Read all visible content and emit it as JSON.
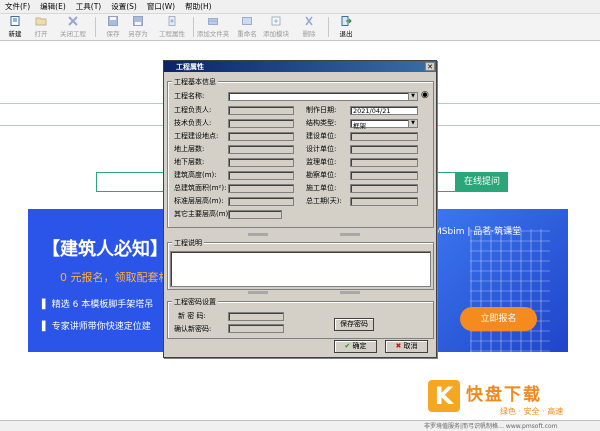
{
  "menu": [
    "文件(F)",
    "编辑(E)",
    "工具(T)",
    "设置(S)",
    "窗口(W)",
    "帮助(H)"
  ],
  "toolbar": [
    {
      "label": "新建",
      "enabled": true,
      "icon": "new-file-icon"
    },
    {
      "label": "打开",
      "enabled": false,
      "icon": "open-folder-icon"
    },
    {
      "label": "关闭工程",
      "enabled": false,
      "icon": "close-project-icon"
    },
    {
      "label": "保存",
      "enabled": false,
      "icon": "save-icon"
    },
    {
      "label": "另存为",
      "enabled": false,
      "icon": "save-as-icon"
    },
    {
      "label": "工程属性",
      "enabled": false,
      "icon": "project-properties-icon"
    },
    {
      "label": "添加文件夹",
      "enabled": false,
      "icon": "add-folder-icon"
    },
    {
      "label": "重命名",
      "enabled": false,
      "icon": "rename-icon"
    },
    {
      "label": "添加模块",
      "enabled": false,
      "icon": "add-module-icon"
    },
    {
      "label": "删除",
      "enabled": false,
      "icon": "delete-icon"
    },
    {
      "label": "退出",
      "enabled": true,
      "icon": "exit-icon"
    }
  ],
  "background": {
    "search_button": "在线提问",
    "banner_title": "【建筑人必知】",
    "banner_offer": "0 元报名，领取配套相",
    "banner_line1": "精选 6 本模板脚手架塔吊",
    "banner_line2": "专家讲师带你快速定位建",
    "banner_brand": "MSbim | 品茗·筑课堂",
    "banner_button": "立即报名",
    "watermark_main": "快盘下载",
    "watermark_sub": "绿色 · 安全 · 高速",
    "status_text": "非罗境值服务|而弓识帆制格… www.pmsoft.com"
  },
  "dialog": {
    "title": "工程属性",
    "basic_group": "工程基本信息",
    "project_name_label": "工程名称:",
    "left_labels": [
      "工程负责人:",
      "技术负责人:",
      "工程建设地点:",
      "地上层数:",
      "地下层数:",
      "建筑高度(m):",
      "总建筑面积(m²):",
      "标准层层高(m):",
      "其它主要层高(m):"
    ],
    "right_labels": [
      "制作日期:",
      "结构类型:",
      "建设单位:",
      "设计单位:",
      "监理单位:",
      "勘察单位:",
      "施工单位:",
      "总工期(天):"
    ],
    "date_value": "2021/04/21",
    "structure_value": "框架",
    "desc_group": "工程说明",
    "pwd_group": "工程密码设置",
    "pwd_label": "新 密 码:",
    "pwd_confirm_label": "确认新密码:",
    "save_pwd_button": "保存密码",
    "ok_button": "确定",
    "cancel_button": "取消",
    "colors": {
      "ok_icon": "#1a9a1a",
      "cancel_icon": "#cc1111"
    }
  }
}
